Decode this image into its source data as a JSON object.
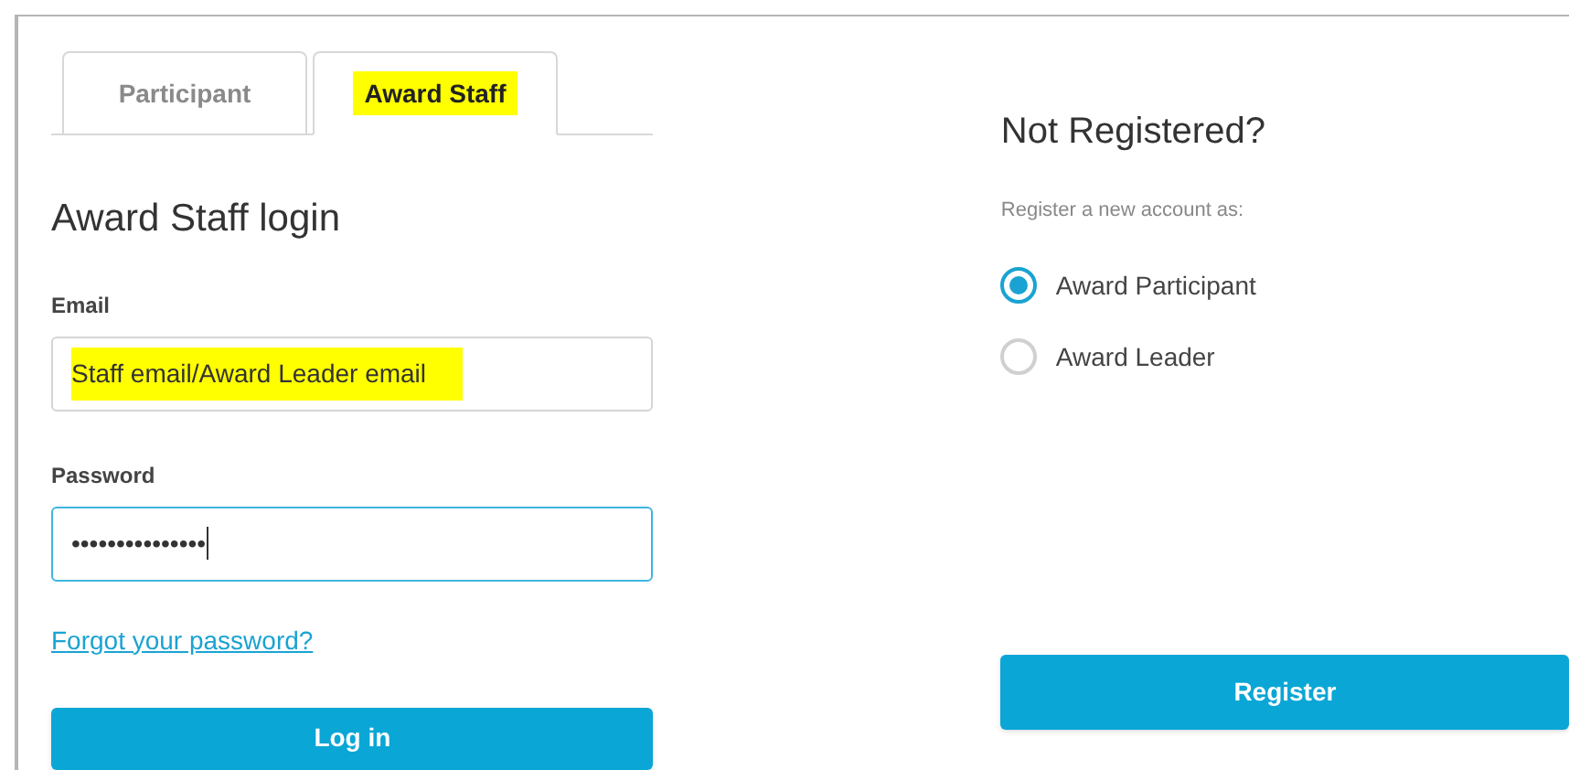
{
  "tabs": [
    {
      "label": "Participant",
      "selected": false,
      "highlighted": false
    },
    {
      "label": "Award Staff",
      "selected": true,
      "highlighted": true
    }
  ],
  "login": {
    "title": "Award Staff login",
    "fields": [
      {
        "label": "Email",
        "value": "Staff email/Award Leader email",
        "highlighted": true,
        "focused": false
      },
      {
        "label": "Password",
        "value": "•••••••••••••••",
        "highlighted": false,
        "focused": true
      }
    ],
    "forgot_link": "Forgot your password?",
    "button": "Log in"
  },
  "register": {
    "title": "Not Registered?",
    "subtitle": "Register a new account as:",
    "options": [
      {
        "label": "Award Participant",
        "selected": true
      },
      {
        "label": "Award Leader",
        "selected": false
      }
    ],
    "button": "Register"
  }
}
